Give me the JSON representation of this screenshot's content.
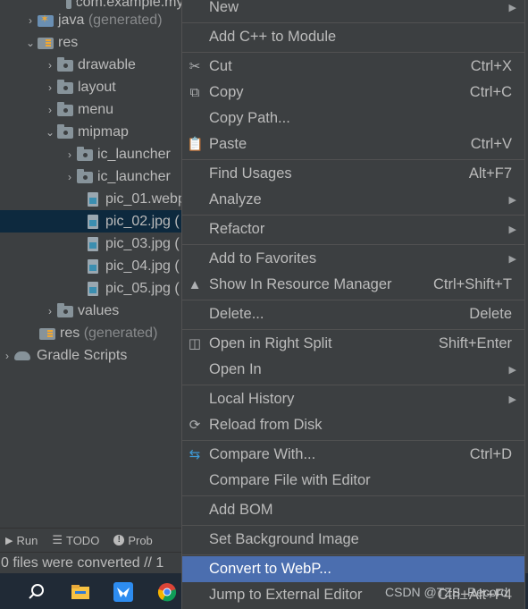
{
  "tree": {
    "items": [
      {
        "label": "com.example.myapplication",
        "generated": ""
      },
      {
        "label": "java",
        "generated": "(generated)"
      },
      {
        "label": "res",
        "generated": ""
      },
      {
        "label": "drawable",
        "generated": ""
      },
      {
        "label": "layout",
        "generated": ""
      },
      {
        "label": "menu",
        "generated": ""
      },
      {
        "label": "mipmap",
        "generated": ""
      },
      {
        "label": "ic_launcher",
        "generated": ""
      },
      {
        "label": "ic_launcher",
        "generated": ""
      },
      {
        "label": "pic_01.webp",
        "generated": ""
      },
      {
        "label": "pic_02.jpg (",
        "generated": ""
      },
      {
        "label": "pic_03.jpg (",
        "generated": ""
      },
      {
        "label": "pic_04.jpg (",
        "generated": ""
      },
      {
        "label": "pic_05.jpg (",
        "generated": ""
      },
      {
        "label": "values",
        "generated": ""
      },
      {
        "label": "res",
        "generated": "(generated)"
      },
      {
        "label": "Gradle Scripts",
        "generated": ""
      }
    ]
  },
  "toolbar": {
    "run": "Run",
    "todo": "TODO",
    "problems": "Prob"
  },
  "status": {
    "text": "0 files were converted // 1"
  },
  "menu": {
    "new": {
      "label": "New"
    },
    "add_cpp": {
      "label": "Add C++ to Module"
    },
    "cut": {
      "label": "Cut",
      "shortcut": "Ctrl+X"
    },
    "copy": {
      "label": "Copy",
      "shortcut": "Ctrl+C"
    },
    "copy_path": {
      "label": "Copy Path..."
    },
    "paste": {
      "label": "Paste",
      "shortcut": "Ctrl+V"
    },
    "find_usages": {
      "label": "Find Usages",
      "shortcut": "Alt+F7"
    },
    "analyze": {
      "label": "Analyze"
    },
    "refactor": {
      "label": "Refactor"
    },
    "add_favorites": {
      "label": "Add to Favorites"
    },
    "show_resource": {
      "label": "Show In Resource Manager",
      "shortcut": "Ctrl+Shift+T"
    },
    "delete": {
      "label": "Delete...",
      "shortcut": "Delete"
    },
    "open_right_split": {
      "label": "Open in Right Split",
      "shortcut": "Shift+Enter"
    },
    "open_in": {
      "label": "Open In"
    },
    "local_history": {
      "label": "Local History"
    },
    "reload": {
      "label": "Reload from Disk"
    },
    "compare_with": {
      "label": "Compare With...",
      "shortcut": "Ctrl+D"
    },
    "compare_file": {
      "label": "Compare File with Editor"
    },
    "add_bom": {
      "label": "Add BOM"
    },
    "set_bg": {
      "label": "Set Background Image"
    },
    "convert_webp": {
      "label": "Convert to WebP..."
    },
    "jump_external": {
      "label": "Jump to External Editor",
      "shortcut": "Ctrl+Alt+F4"
    }
  },
  "watermark": "CSDN @TZS_Record",
  "colors": {
    "highlight": "#4b6eaf",
    "panel": "#3c3f41",
    "selected_row": "#0d293e"
  }
}
